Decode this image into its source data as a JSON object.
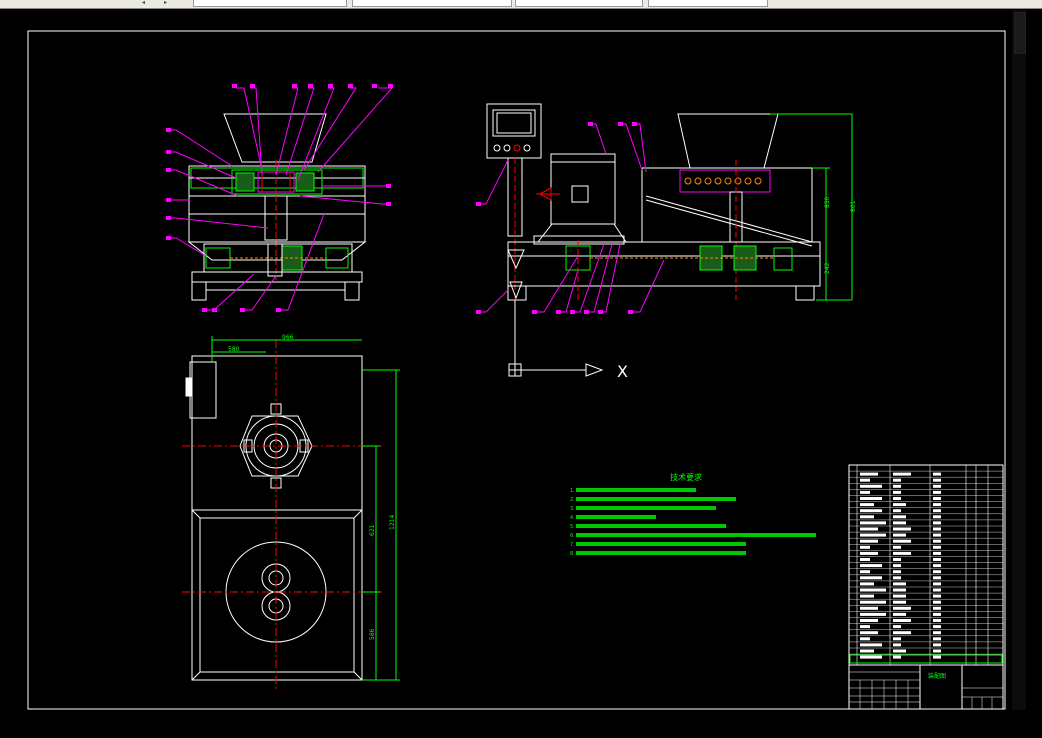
{
  "drawing": {
    "dimensions": {
      "top_width": "966",
      "top_offset": "580",
      "height_left": "850",
      "height_left_lower": "242",
      "height_total": "801",
      "plan_upper": "621",
      "plan_total": "1214",
      "plan_lower": "586"
    },
    "axis_label_x": "X",
    "technical_requirements": {
      "title": "技术要求",
      "lines": [
        "1.",
        "2.",
        "3.",
        "4.",
        "5.",
        "6.",
        "7.",
        "8."
      ]
    },
    "title_block": {
      "name_cell": "装配图"
    }
  },
  "colors": {
    "line_white": "#ffffff",
    "dim_green": "#00ff00",
    "leader_magenta": "#ff00ff",
    "center_red": "#ff0000",
    "part_orange": "#ff8800",
    "frame_border": "#ffffff",
    "toolbar_bg": "#ece9e0"
  }
}
